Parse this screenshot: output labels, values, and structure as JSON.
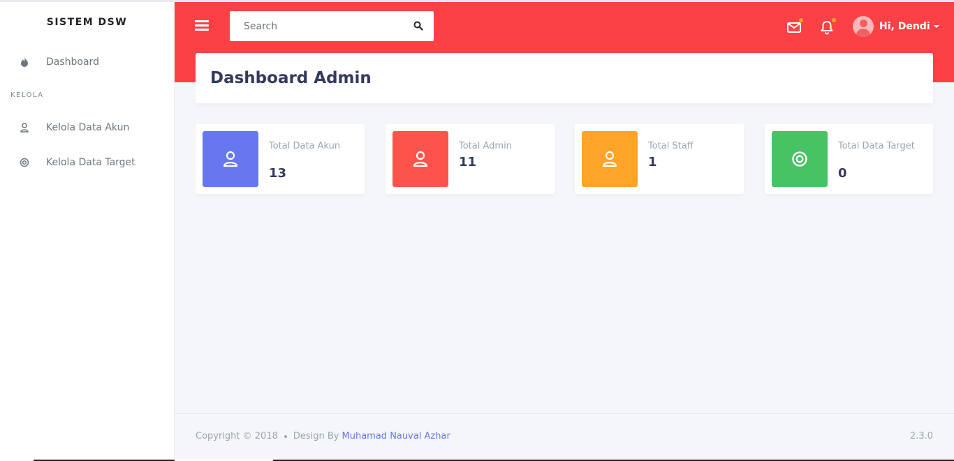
{
  "sidebar": {
    "brand": "SISTEM DSW",
    "dashboard_label": "Dashboard",
    "section_header": "KELOLA",
    "items": [
      {
        "label": "Kelola Data Akun",
        "icon": "user-icon"
      },
      {
        "label": "Kelola Data Target",
        "icon": "target-icon"
      }
    ]
  },
  "navbar": {
    "search_placeholder": "Search",
    "user_greeting": "Hi, Dendi",
    "accent_color": "#fc4146",
    "notification_dot_color": "#ffa426"
  },
  "main": {
    "title": "Dashboard Admin",
    "cards": [
      {
        "label": "Total Data Akun",
        "value": "13",
        "color": "#6777ef",
        "icon": "user-icon"
      },
      {
        "label": "Total Admin",
        "value": "11",
        "color": "#fc544b",
        "icon": "user-icon"
      },
      {
        "label": "Total Staff",
        "value": "1",
        "color": "#ffa426",
        "icon": "user-icon"
      },
      {
        "label": "Total Data Target",
        "value": "0",
        "color": "#47c363",
        "icon": "target-icon"
      }
    ]
  },
  "footer": {
    "copyright": "Copyright © 2018",
    "design_by": "Design By",
    "author": "Muhamad Nauval Azhar",
    "version": "2.3.0"
  }
}
